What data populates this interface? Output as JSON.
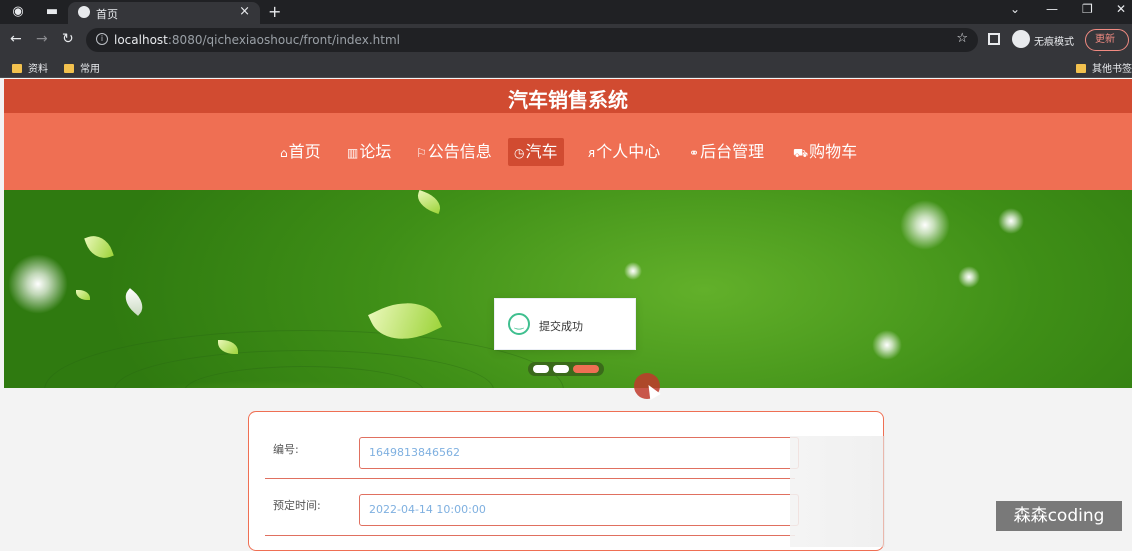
{
  "browser": {
    "tab_title": "首页",
    "url_host": "localhost",
    "url_rest": ":8080/qichexiaoshouc/front/index.html",
    "incognito_label": "无痕模式",
    "update_label": "更新",
    "bookmarks": [
      "资料",
      "常用"
    ],
    "other_bookmarks": "其他书签"
  },
  "site": {
    "title": "汽车销售系统",
    "nav": [
      {
        "icon": "⌂",
        "label": "首页"
      },
      {
        "icon": "▥",
        "label": "论坛"
      },
      {
        "icon": "⚐",
        "label": "公告信息"
      },
      {
        "icon": "◷",
        "label": "汽车"
      },
      {
        "icon": "ᴙ",
        "label": "个人中心"
      },
      {
        "icon": "⚭",
        "label": "后台管理"
      },
      {
        "icon": "⛟",
        "label": "购物车"
      }
    ],
    "active_nav": "汽车"
  },
  "toast": {
    "text": "提交成功",
    "icon": "smile-icon"
  },
  "form": {
    "fields": [
      {
        "label": "编号:",
        "value": "1649813846562"
      },
      {
        "label": "预定时间:",
        "value": "2022-04-14 10:00:00"
      }
    ]
  },
  "watermark": "森森coding",
  "colors": {
    "header_dark": "#d14b31",
    "header": "#ef6f53",
    "success": "#3fbf8f"
  }
}
